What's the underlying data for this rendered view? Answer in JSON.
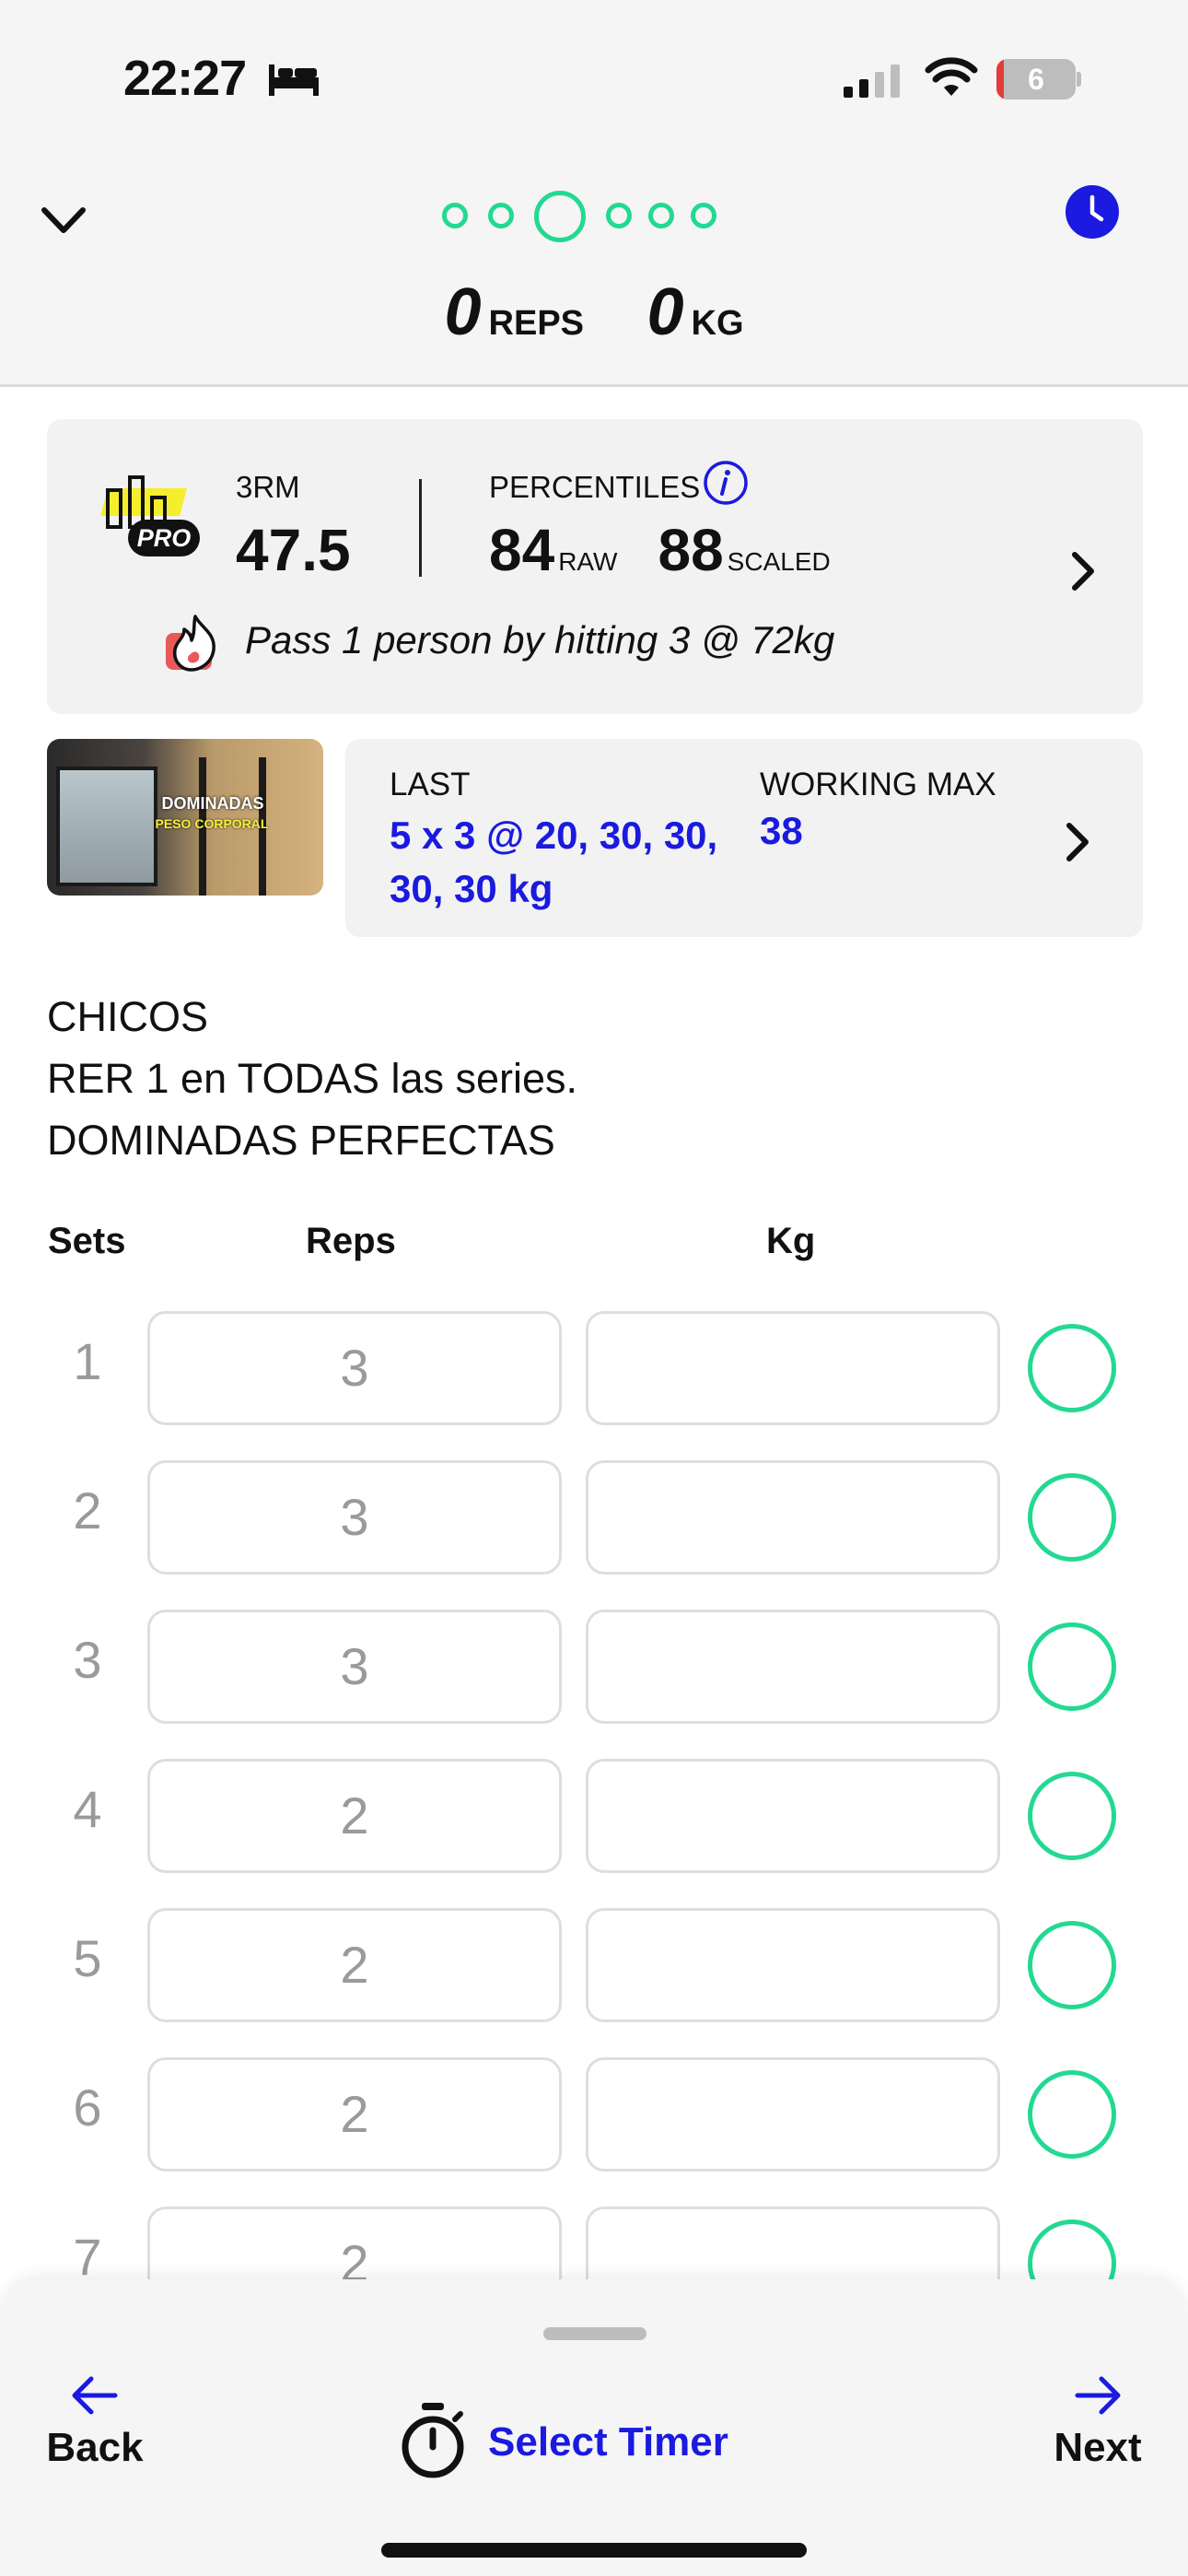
{
  "status_bar": {
    "time": "22:27",
    "battery": "6",
    "icons": [
      "bed-icon",
      "cellular-signal-icon",
      "wifi-icon",
      "battery-icon"
    ]
  },
  "header": {
    "progress_dots": 6,
    "active_dot": 3,
    "total_reps": "0",
    "reps_unit": "REPS",
    "total_kg": "0",
    "kg_unit": "KG",
    "accent_color": "#23d992"
  },
  "stats": {
    "rm_label": "3RM",
    "rm_value": "47.5",
    "percentiles_label": "PERCENTILES",
    "raw_value": "84",
    "raw_label": "RAW",
    "scaled_value": "88",
    "scaled_label": "SCALED",
    "challenge": "Pass 1 person by hitting 3 @ 72kg"
  },
  "video": {
    "title": "DOMINADAS",
    "subtitle": "PESO CORPORAL"
  },
  "last_card": {
    "last_label": "LAST",
    "last_value": "5 x 3 @ 20, 30, 30, 30, 30 kg",
    "working_max_label": "WORKING MAX",
    "working_max_value": "38",
    "link_color": "#1a1ae0"
  },
  "notes": {
    "line1": "CHICOS",
    "line2": "RER 1 en TODAS las series.",
    "line3": "DOMINADAS PERFECTAS"
  },
  "table": {
    "col_sets": "Sets",
    "col_reps": "Reps",
    "col_kg": "Kg",
    "rows": [
      {
        "set": "1",
        "reps": "3",
        "kg": ""
      },
      {
        "set": "2",
        "reps": "3",
        "kg": ""
      },
      {
        "set": "3",
        "reps": "3",
        "kg": ""
      },
      {
        "set": "4",
        "reps": "2",
        "kg": ""
      },
      {
        "set": "5",
        "reps": "2",
        "kg": ""
      },
      {
        "set": "6",
        "reps": "2",
        "kg": ""
      },
      {
        "set": "7",
        "reps": "2",
        "kg": ""
      }
    ]
  },
  "bottom_bar": {
    "back_label": "Back",
    "timer_label": "Select Timer",
    "next_label": "Next"
  }
}
